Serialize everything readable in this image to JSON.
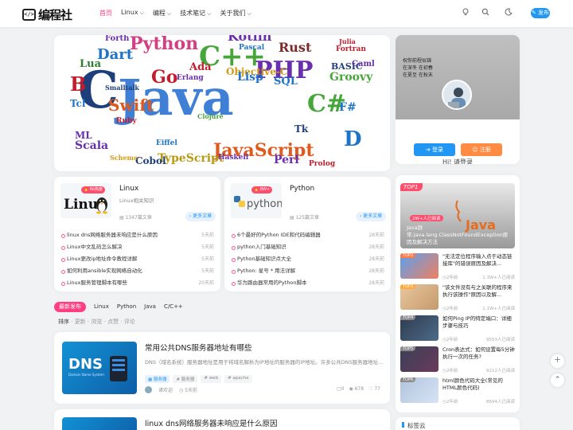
{
  "nav": {
    "logo_mark": "</>",
    "logo_text": "编程社",
    "menu": [
      {
        "label": "首页",
        "active": true
      },
      {
        "label": "Linux",
        "dropdown": true
      },
      {
        "label": "编程",
        "dropdown": true
      },
      {
        "label": "技术笔记",
        "dropdown": true
      },
      {
        "label": "关于我们",
        "dropdown": true
      }
    ],
    "icons": [
      "bulb-icon",
      "search-icon",
      "moon-icon"
    ],
    "publish_label": "发布"
  },
  "hero": {
    "words": [
      {
        "t": "Java",
        "c": "#3f7fd6",
        "s": 62
      },
      {
        "t": "C",
        "c": "#1f3f7a",
        "s": 64
      },
      {
        "t": "C++",
        "c": "#46a63a",
        "s": 34
      },
      {
        "t": "Python",
        "c": "#d23f82",
        "s": 22
      },
      {
        "t": "PHP",
        "c": "#6a2fb0",
        "s": 30
      },
      {
        "t": "JavaScript",
        "c": "#e05a1e",
        "s": 22
      },
      {
        "t": "TypeScript",
        "c": "#b89a12",
        "s": 14
      },
      {
        "t": "Swift",
        "c": "#e05a1e",
        "s": 20
      },
      {
        "t": "Kotlin",
        "c": "#6a2fb0",
        "s": 16
      },
      {
        "t": "Rust",
        "c": "#7a2a2a",
        "s": 16
      },
      {
        "t": "Dart",
        "c": "#1d74c9",
        "s": 18
      },
      {
        "t": "Go",
        "c": "#c21d2d",
        "s": 22
      },
      {
        "t": "Scala",
        "c": "#6a2fb0",
        "s": 14
      },
      {
        "t": "C#",
        "c": "#46a63a",
        "s": 30
      },
      {
        "t": "Groovy",
        "c": "#46a63a",
        "s": 14
      },
      {
        "t": "Objective-C",
        "c": "#d29a12",
        "s": 12
      },
      {
        "t": "Haskell",
        "c": "#6a2fb0",
        "s": 9
      },
      {
        "t": "Perl",
        "c": "#6a2fb0",
        "s": 14
      },
      {
        "t": "Ruby",
        "c": "#c21d2d",
        "s": 9
      },
      {
        "t": "Lua",
        "c": "#2e7d32",
        "s": 13
      },
      {
        "t": "Lisp",
        "c": "#1d74c9",
        "s": 14
      },
      {
        "t": "SQL",
        "c": "#1d74c9",
        "s": 13
      },
      {
        "t": "Cobol",
        "c": "#1f3f7a",
        "s": 12
      },
      {
        "t": "Fortran",
        "c": "#c21d2d",
        "s": 9
      },
      {
        "t": "BASIC",
        "c": "#1f3f7a",
        "s": 11
      },
      {
        "t": "Julia",
        "c": "#c21d2d",
        "s": 8
      },
      {
        "t": "Eiffel",
        "c": "#1d74c9",
        "s": 9
      },
      {
        "t": "Prolog",
        "c": "#c21d2d",
        "s": 9
      },
      {
        "t": "ML",
        "c": "#6a2fb0",
        "s": 12
      },
      {
        "t": "Tcl",
        "c": "#1d74c9",
        "s": 12
      },
      {
        "t": "B",
        "c": "#c21d2d",
        "s": 24
      },
      {
        "t": "Ada",
        "c": "#c21d2d",
        "s": 13
      },
      {
        "t": "Pascal",
        "c": "#1d74c9",
        "s": 9
      },
      {
        "t": "Erlang",
        "c": "#6a2fb0",
        "s": 9
      },
      {
        "t": "Forth",
        "c": "#6a2fb0",
        "s": 10
      },
      {
        "t": "D",
        "c": "#1d74c9",
        "s": 26
      },
      {
        "t": "Tk",
        "c": "#1f3f7a",
        "s": 12
      },
      {
        "t": "Caml",
        "c": "#6a2fb0",
        "s": 10
      },
      {
        "t": "F#",
        "c": "#1d74c9",
        "s": 14
      },
      {
        "t": "Smalltalk",
        "c": "#1f3f7a",
        "s": 8
      },
      {
        "t": "Clojure",
        "c": "#46a63a",
        "s": 8
      },
      {
        "t": "Scheme",
        "c": "#d29a12",
        "s": 8
      }
    ]
  },
  "profile": {
    "slogan": [
      "祝你前程似锦",
      "在深冬 在初春",
      "在夏至 在秋末"
    ],
    "greeting": "Hi! 请登录",
    "login_label": "登录",
    "register_label": "注册"
  },
  "categories": [
    {
      "logo_word": "Linux",
      "hot": "6k热度",
      "title": "Linux",
      "desc": "Linux相关知识",
      "count": "1347篇文章",
      "more": "更多文章",
      "items": [
        {
          "title": "linux dns网络服务器未响应是什么原因",
          "time": "5天前"
        },
        {
          "title": "Linux中文乱码怎么解决",
          "time": "5天前"
        },
        {
          "title": "Linux更改ip地址命令教程详解",
          "time": "5天前"
        },
        {
          "title": "如何利用ansible实现网络自动化",
          "time": "5天前"
        },
        {
          "title": "Linux服务管理脚本有哪些",
          "time": "20天前"
        }
      ]
    },
    {
      "logo_word": "python",
      "hot": "8W+",
      "title": "Python",
      "desc": "",
      "count": "125篇文章",
      "more": "更多文章",
      "items": [
        {
          "title": "6个最好的Python IDE和代码编辑器",
          "time": "28天前"
        },
        {
          "title": "python入门基础知识",
          "time": "28天前"
        },
        {
          "title": "Python基础知识点大全",
          "time": "28天前"
        },
        {
          "title": "Python: 星号 * 用法详解",
          "time": "28天前"
        },
        {
          "title": "华为路由器常用的Python脚本",
          "time": "28天前"
        }
      ]
    }
  ],
  "tabs": [
    "最新发布",
    "Linux",
    "Python",
    "Java",
    "C/C++"
  ],
  "sort": {
    "active": "排序",
    "options": [
      "更新",
      "浏览",
      "点赞",
      "评论"
    ]
  },
  "posts": [
    {
      "thumb_text": "DNS",
      "thumb_sub": "Domain Name System",
      "title": "常用公共DNS服务器地址有哪些",
      "excerpt": "DNS（域名系统）服务器地址是用于将域名解析为IP地址的服务器的IP地址。许多公共DNS服务器地址...",
      "tags": [
        "服务器",
        "# 服务器",
        "# web",
        "# apache"
      ],
      "author": "诸欢迎",
      "time": "5天前",
      "comments": "0",
      "views": "678",
      "likes": "77"
    },
    {
      "title": "linux dns网络服务器未响应是什么原因"
    }
  ],
  "hot": {
    "top1": {
      "badge": "TOP1",
      "views": "2W+人已阅读",
      "title": "Java异常:java.lang.ClassNotFoundException原因及解决方法"
    },
    "items": [
      {
        "badge": "TOP2",
        "color": "#ff7a45",
        "title": "\"无法定位程序输入点于动态链接库\"的错误原因及解决...",
        "date": "2年前",
        "views": "1.3W+人已阅读"
      },
      {
        "badge": "TOP3",
        "color": "#ffa940",
        "title": "\"该文件没有与之关联的程序来执行该操作\"原因以及解...",
        "date": "2年前",
        "views": "1.1W+人已阅读"
      },
      {
        "badge": "TOP4",
        "color": "#8c8c8c",
        "title": "如何Ping IP的特定端口：详细步骤与技巧",
        "date": "2年前",
        "views": "9553人已阅读"
      },
      {
        "badge": "TOP5",
        "color": "#8c8c8c",
        "title": "Cron表达式：如何设置每5分钟执行一次的任务?",
        "date": "2年前",
        "views": "9212人已阅读"
      },
      {
        "badge": "TOP6",
        "color": "#8c8c8c",
        "title": "html颜色代码大全(常见的HTML颜色代码)",
        "date": "2年前",
        "views": "8694人已阅读"
      }
    ]
  },
  "tagcloud_title": "标签云",
  "colors": {
    "accent": "#ff3f7f",
    "blue": "#2196f3",
    "orange": "#ff8c42",
    "hot": "#ff4d6d"
  }
}
